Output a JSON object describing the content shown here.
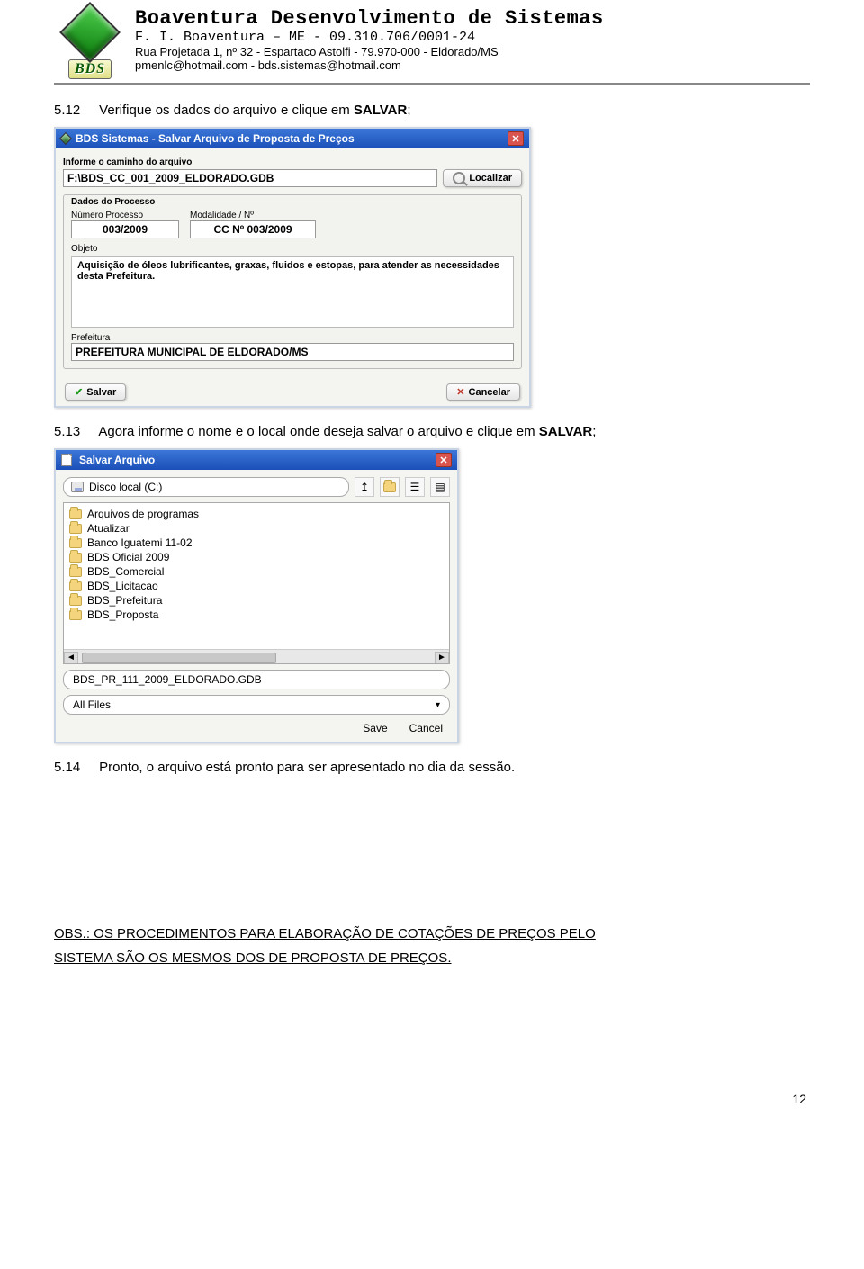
{
  "header": {
    "title": "Boaventura Desenvolvimento de Sistemas",
    "sub": "F. I. Boaventura – ME    -    09.310.706/0001-24",
    "addr": "Rua Projetada 1, nº 32 - Espartaco Astolfi - 79.970-000 - Eldorado/MS",
    "contact": "pmenlc@hotmail.com    -    bds.sistemas@hotmail.com",
    "bds_label": "BDS"
  },
  "steps": {
    "s512_num": "5.12",
    "s512_text": "Verifique os dados do arquivo e clique em ",
    "s512_bold": "SALVAR",
    "s513_num": "5.13",
    "s513_text": "Agora informe o nome e o local onde deseja salvar o arquivo e clique em ",
    "s513_bold": "SALVAR",
    "s514_num": "5.14",
    "s514_text": "Pronto, o arquivo está pronto para ser apresentado no dia da sessão."
  },
  "obs_line1": "OBS.: OS PROCEDIMENTOS PARA ELABORAÇÃO DE COTAÇÕES DE PREÇOS PELO",
  "obs_line2": "SISTEMA SÃO OS MESMOS DOS DE PROPOSTA DE PREÇOS.",
  "page_number": "12",
  "shot1": {
    "title": "BDS Sistemas   -   Salvar Arquivo de Proposta de Preços",
    "label_caminho": "Informe o caminho do arquivo",
    "path_value": "F:\\BDS_CC_001_2009_ELDORADO.GDB",
    "btn_localizar": "Localizar",
    "fs_dados": "Dados do Processo",
    "lbl_numero": "Número Processo",
    "lbl_modalidade": "Modalidade / Nº",
    "val_numero": "003/2009",
    "val_modalidade": "CC Nº 003/2009",
    "lbl_objeto": "Objeto",
    "val_objeto": "Aquisição de óleos lubrificantes, graxas, fluidos e estopas, para atender as necessidades desta Prefeitura.",
    "lbl_prefeitura": "Prefeitura",
    "val_prefeitura": "PREFEITURA MUNICIPAL DE ELDORADO/MS",
    "btn_salvar": "Salvar",
    "btn_cancelar": "Cancelar"
  },
  "shot2": {
    "title": "Salvar Arquivo",
    "drive": "Disco local (C:)",
    "items": [
      "Arquivos de programas",
      "Atualizar",
      "Banco Iguatemi 11-02",
      "BDS Oficial 2009",
      "BDS_Comercial",
      "BDS_Licitacao",
      "BDS_Prefeitura",
      "BDS_Proposta"
    ],
    "filename": "BDS_PR_111_2009_ELDORADO.GDB",
    "filter": "All Files",
    "save": "Save",
    "cancel": "Cancel"
  }
}
